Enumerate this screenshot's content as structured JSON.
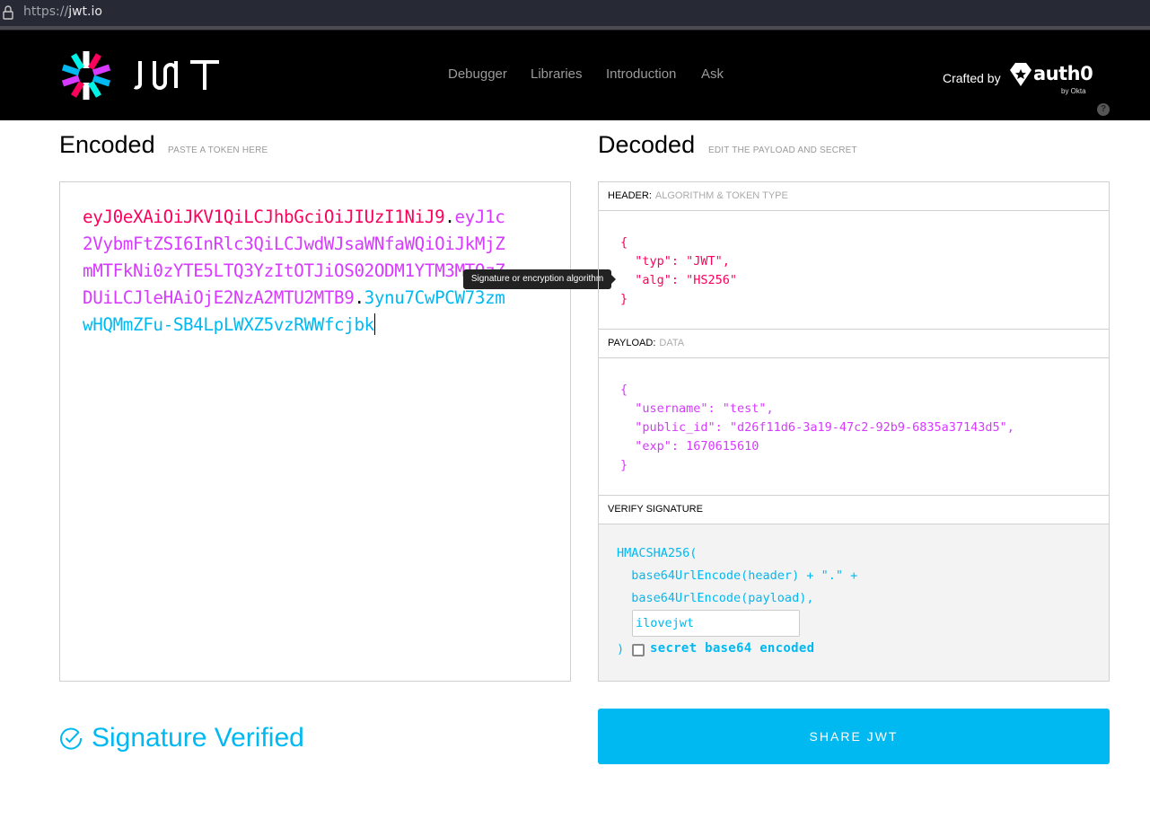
{
  "browser": {
    "url_scheme": "https://",
    "url_host": "jwt.io"
  },
  "nav": {
    "logo_text": "JWT",
    "links": [
      "Debugger",
      "Libraries",
      "Introduction",
      "Ask"
    ],
    "crafted_by": "Crafted by",
    "brand": "auth0",
    "brand_sub": "by Okta",
    "help": "?"
  },
  "encoded": {
    "title": "Encoded",
    "subtitle": "PASTE A TOKEN HERE",
    "token": {
      "header": "eyJ0eXAiOiJKV1QiLCJhbGciOiJIUzI1NiJ9",
      "payload": "eyJ1c2VybmFtZSI6InRlc3QiLCJwdWJsaWNfaWQiOiJkMjZmMTFkNi0zYTE5LTQ3YzItOTJiOS02ODM1YTM3MTQzZDUiLCJleHAiOjE2NzA2MTU2MTB9",
      "signature": "3ynu7CwPCW73zmwHQMmZFu-SB4LpLWXZ5vzRWWfcjbk",
      "dot": "."
    },
    "tooltip": "Signature or encryption algorithm"
  },
  "decoded": {
    "title": "Decoded",
    "subtitle": "EDIT THE PAYLOAD AND SECRET",
    "header_label": "HEADER:",
    "header_desc": "ALGORITHM & TOKEN TYPE",
    "header_json": "{\n  \"typ\": \"JWT\",\n  \"alg\": \"HS256\"\n}",
    "payload_label": "PAYLOAD:",
    "payload_desc": "DATA",
    "payload_json": "{\n  \"username\": \"test\",\n  \"public_id\": \"d26f11d6-3a19-47c2-92b9-6835a37143d5\",\n  \"exp\": 1670615610\n}",
    "verify_label": "VERIFY SIGNATURE",
    "verify_line1": "HMACSHA256(",
    "verify_line2": "  base64UrlEncode(header) + \".\" +",
    "verify_line3": "  base64UrlEncode(payload),",
    "secret_value": "ilovejwt",
    "verify_close": ")",
    "base64_label": "secret base64 encoded",
    "base64_checked": false
  },
  "status": {
    "verified_text": "Signature Verified",
    "color": "#00b9f1"
  },
  "share_button": "SHARE JWT",
  "colors": {
    "header": "#fb015b",
    "payload": "#d63aff",
    "signature": "#00b9f1"
  }
}
